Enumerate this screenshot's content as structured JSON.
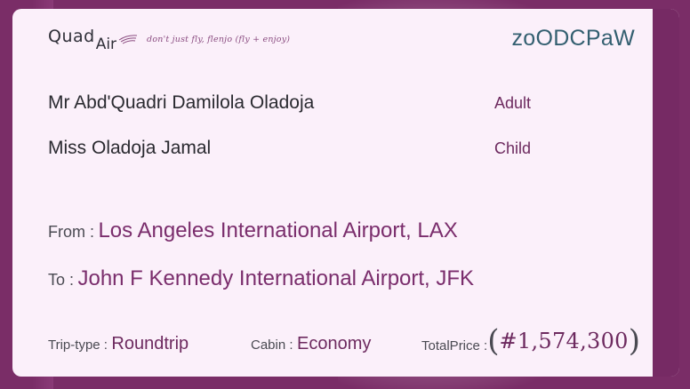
{
  "brand": {
    "name_part1": "Quad",
    "name_part2": "Air",
    "tagline": "don't just fly, flenjo (fly + enjoy)"
  },
  "booking": {
    "reference": "zoODCPaW"
  },
  "passengers": [
    {
      "name": "Mr Abd'Quadri Damilola Oladoja",
      "type": "Adult"
    },
    {
      "name": "Miss Oladoja Jamal",
      "type": "Child"
    }
  ],
  "route": {
    "from_label": "From :",
    "from_value": "Los Angeles International Airport, LAX",
    "to_label": "To :",
    "to_value": "John F Kennedy International Airport, JFK"
  },
  "trip": {
    "trip_type_label": "Trip-type :",
    "trip_type_value": "Roundtrip",
    "cabin_label": "Cabin :",
    "cabin_value": "Economy",
    "total_price_label": "TotalPrice :",
    "total_price_value": "#1,574,300"
  },
  "colors": {
    "background": "#7a2d67",
    "card": "#fbf0fa",
    "accent": "#6d2a5f",
    "reference": "#335f70"
  }
}
